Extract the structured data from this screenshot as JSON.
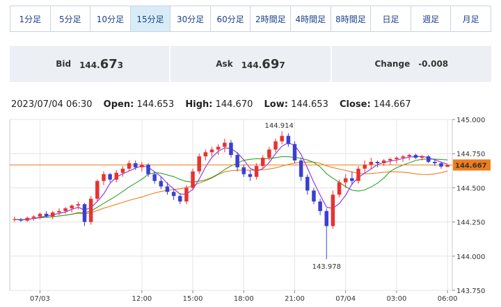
{
  "timeframes": [
    {
      "label": "1分足",
      "active": false
    },
    {
      "label": "5分足",
      "active": false
    },
    {
      "label": "10分足",
      "active": false
    },
    {
      "label": "15分足",
      "active": true
    },
    {
      "label": "30分足",
      "active": false
    },
    {
      "label": "60分足",
      "active": false
    },
    {
      "label": "2時間足",
      "active": false
    },
    {
      "label": "4時間足",
      "active": false
    },
    {
      "label": "8時間足",
      "active": false
    },
    {
      "label": "日足",
      "active": false
    },
    {
      "label": "週足",
      "active": false
    },
    {
      "label": "月足",
      "active": false
    }
  ],
  "quote": {
    "bid_label": "Bid",
    "bid_main": "144.",
    "bid_big": "67",
    "bid_small": "3",
    "ask_label": "Ask",
    "ask_main": "144.",
    "ask_big": "69",
    "ask_small": "7",
    "change_label": "Change",
    "change_value": "-0.008"
  },
  "ohlc": {
    "timestamp": "2023/07/04 06:30",
    "open_label": "Open:",
    "open": "144.653",
    "high_label": "High:",
    "high": "144.670",
    "low_label": "Low:",
    "low": "144.653",
    "close_label": "Close:",
    "close": "144.667"
  },
  "colors": {
    "up": "#e8322f",
    "down": "#3b3fd0",
    "ma_fast": "#8a2be2",
    "ma_mid": "#2ca02c",
    "ma_slow": "#f07d1a",
    "current": "#f07d1a"
  },
  "chart_data": {
    "type": "candlestick",
    "ylim": [
      143.75,
      145.0
    ],
    "yticks": [
      "145.000",
      "144.750",
      "144.500",
      "144.250",
      "144.000",
      "143.750"
    ],
    "xticks": [
      {
        "label": "07/03",
        "index": 4
      },
      {
        "label": "12:00",
        "index": 20
      },
      {
        "label": "15:00",
        "index": 28
      },
      {
        "label": "18:00",
        "index": 36
      },
      {
        "label": "21:00",
        "index": 44
      },
      {
        "label": "07/04",
        "index": 52
      },
      {
        "label": "03:00",
        "index": 60
      },
      {
        "label": "06:00",
        "index": 68
      }
    ],
    "current_price": "144.667",
    "high_annotation": {
      "label": "144.914",
      "index": 42,
      "value": 144.914
    },
    "low_annotation": {
      "label": "143.978",
      "index": 49,
      "value": 143.978
    },
    "ohlc": [
      [
        144.27,
        144.29,
        144.25,
        144.27
      ],
      [
        144.27,
        144.28,
        144.25,
        144.26
      ],
      [
        144.26,
        144.29,
        144.25,
        144.28
      ],
      [
        144.28,
        144.3,
        144.26,
        144.29
      ],
      [
        144.29,
        144.32,
        144.27,
        144.31
      ],
      [
        144.31,
        144.33,
        144.28,
        144.29
      ],
      [
        144.29,
        144.33,
        144.27,
        144.32
      ],
      [
        144.32,
        144.35,
        144.3,
        144.33
      ],
      [
        144.33,
        144.36,
        144.31,
        144.35
      ],
      [
        144.35,
        144.38,
        144.32,
        144.37
      ],
      [
        144.37,
        144.4,
        144.34,
        144.38
      ],
      [
        144.38,
        144.39,
        144.22,
        144.25
      ],
      [
        144.25,
        144.44,
        144.23,
        144.42
      ],
      [
        144.42,
        144.56,
        144.4,
        144.55
      ],
      [
        144.55,
        144.62,
        144.52,
        144.6
      ],
      [
        144.6,
        144.61,
        144.54,
        144.56
      ],
      [
        144.56,
        144.63,
        144.54,
        144.61
      ],
      [
        144.61,
        144.66,
        144.58,
        144.64
      ],
      [
        144.64,
        144.7,
        144.62,
        144.68
      ],
      [
        144.68,
        144.7,
        144.63,
        144.65
      ],
      [
        144.65,
        144.69,
        144.62,
        144.67
      ],
      [
        144.67,
        144.68,
        144.58,
        144.6
      ],
      [
        144.6,
        144.62,
        144.53,
        144.55
      ],
      [
        144.55,
        144.58,
        144.49,
        144.51
      ],
      [
        144.51,
        144.54,
        144.45,
        144.47
      ],
      [
        144.47,
        144.49,
        144.41,
        144.44
      ],
      [
        144.44,
        144.46,
        144.38,
        144.4
      ],
      [
        144.4,
        144.52,
        144.38,
        144.5
      ],
      [
        144.5,
        144.64,
        144.48,
        144.62
      ],
      [
        144.62,
        144.75,
        144.6,
        144.73
      ],
      [
        144.73,
        144.78,
        144.7,
        144.76
      ],
      [
        144.76,
        144.8,
        144.73,
        144.78
      ],
      [
        144.78,
        144.82,
        144.74,
        144.8
      ],
      [
        144.8,
        144.86,
        144.76,
        144.83
      ],
      [
        144.83,
        144.85,
        144.72,
        144.74
      ],
      [
        144.74,
        144.76,
        144.62,
        144.65
      ],
      [
        144.65,
        144.67,
        144.58,
        144.6
      ],
      [
        144.6,
        144.63,
        144.55,
        144.58
      ],
      [
        144.58,
        144.68,
        144.56,
        144.66
      ],
      [
        144.66,
        144.74,
        144.64,
        144.72
      ],
      [
        144.72,
        144.8,
        144.7,
        144.78
      ],
      [
        144.78,
        144.86,
        144.76,
        144.84
      ],
      [
        144.84,
        144.914,
        144.82,
        144.88
      ],
      [
        144.88,
        144.9,
        144.8,
        144.82
      ],
      [
        144.82,
        144.84,
        144.68,
        144.7
      ],
      [
        144.7,
        144.72,
        144.55,
        144.58
      ],
      [
        144.58,
        144.6,
        144.45,
        144.48
      ],
      [
        144.48,
        144.5,
        144.38,
        144.4
      ],
      [
        144.4,
        144.42,
        144.3,
        144.33
      ],
      [
        144.33,
        144.35,
        143.978,
        144.22
      ],
      [
        144.22,
        144.48,
        144.2,
        144.45
      ],
      [
        144.45,
        144.56,
        144.43,
        144.54
      ],
      [
        144.54,
        144.6,
        144.5,
        144.57
      ],
      [
        144.57,
        144.62,
        144.52,
        144.55
      ],
      [
        144.55,
        144.66,
        144.53,
        144.64
      ],
      [
        144.64,
        144.7,
        144.61,
        144.67
      ],
      [
        144.67,
        144.72,
        144.64,
        144.69
      ],
      [
        144.69,
        144.7,
        144.65,
        144.68
      ],
      [
        144.68,
        144.71,
        144.66,
        144.7
      ],
      [
        144.7,
        144.72,
        144.67,
        144.71
      ],
      [
        144.71,
        144.73,
        144.68,
        144.72
      ],
      [
        144.72,
        144.74,
        144.69,
        144.73
      ],
      [
        144.73,
        144.75,
        144.7,
        144.74
      ],
      [
        144.74,
        144.75,
        144.71,
        144.72
      ],
      [
        144.72,
        144.74,
        144.7,
        144.73
      ],
      [
        144.73,
        144.74,
        144.68,
        144.69
      ],
      [
        144.69,
        144.71,
        144.66,
        144.68
      ],
      [
        144.68,
        144.69,
        144.64,
        144.655
      ],
      [
        144.653,
        144.67,
        144.653,
        144.667
      ]
    ]
  }
}
